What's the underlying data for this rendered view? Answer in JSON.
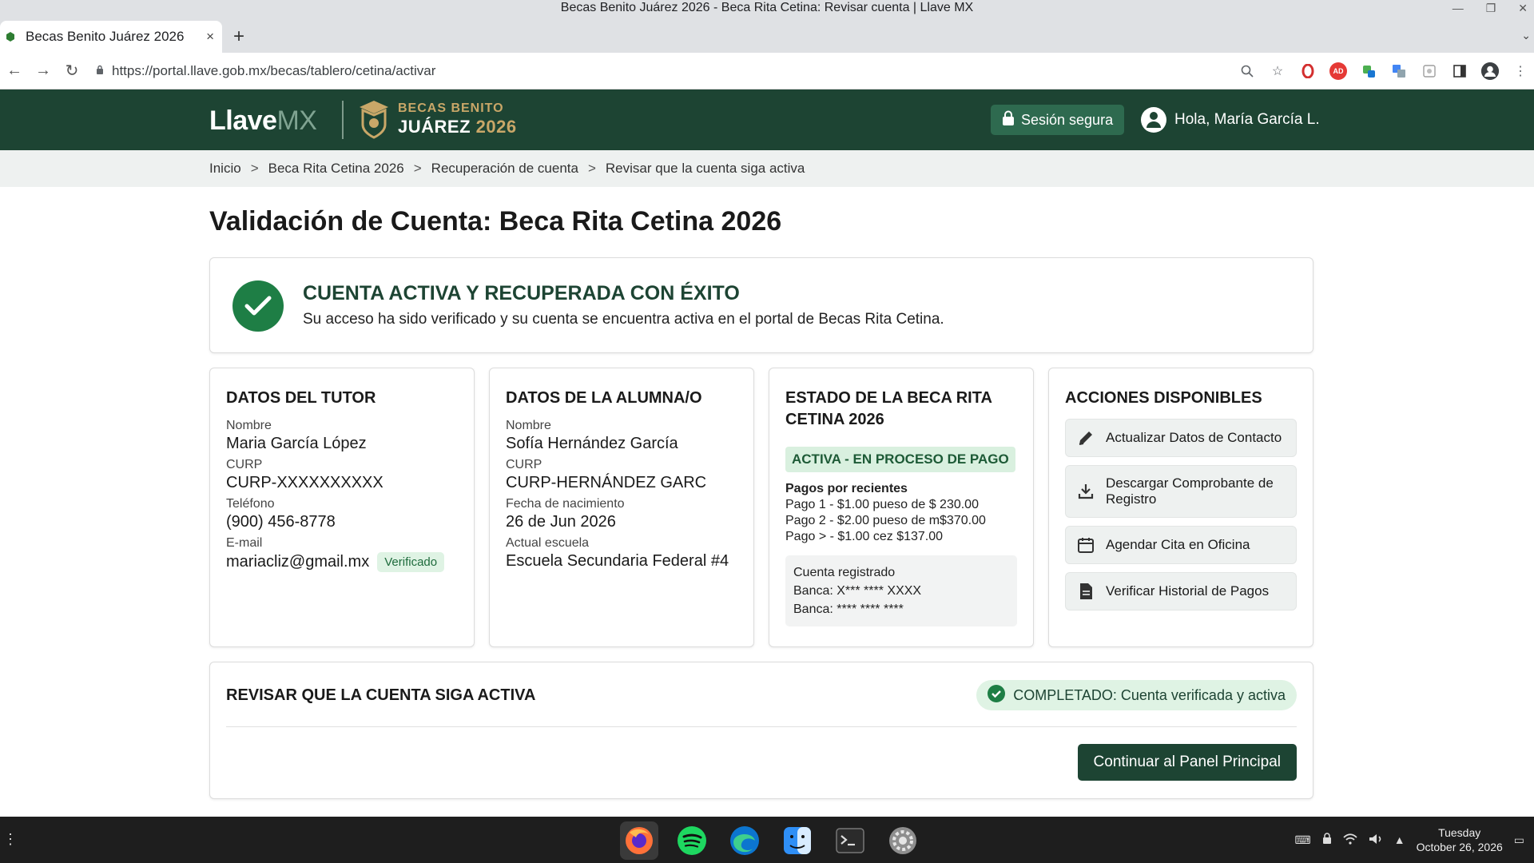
{
  "window": {
    "title": "Becas Benito Juárez 2026 - Beca Rita Cetina: Revisar cuenta | Llave MX",
    "controls": [
      "—",
      "❐",
      "✕"
    ]
  },
  "tab": {
    "title": "Becas Benito Juárez 2026",
    "close": "×",
    "new_tab": "+"
  },
  "toolbar": {
    "back": "←",
    "forward": "→",
    "reload": "↻",
    "url": "https://portal.llave.gob.mx/becas/tablero/cetina/activar"
  },
  "header": {
    "logo_llave": "Llave",
    "logo_mx": "MX",
    "becas_line1": "BECAS BENITO",
    "becas_line2": "JUÁREZ",
    "becas_year": "2026",
    "secure_label": "Sesión segura",
    "greeting": "Hola, María García L."
  },
  "breadcrumb": {
    "separator": ">",
    "items": [
      "Inicio",
      "Beca Rita Cetina 2026",
      "Recuperación de cuenta",
      "Revisar que la cuenta siga activa"
    ]
  },
  "page_title": "Validación de Cuenta: Beca Rita Cetina 2026",
  "success": {
    "title": "CUENTA ACTIVA Y RECUPERADA CON ÉXITO",
    "description": "Su acceso ha sido verificado y su cuenta se encuentra activa en el portal de Becas Rita Cetina."
  },
  "tutor": {
    "heading": "DATOS DEL TUTOR",
    "name_label": "Nombre",
    "name": "Maria García López",
    "curp_label": "CURP",
    "curp": "CURP-XXXXXXXXXX",
    "phone_label": "Teléfono",
    "phone": "(900) 456-8778",
    "email_label": "E-mail",
    "email": "mariacliz@gmail.mx",
    "verified": "Verificado"
  },
  "alumno": {
    "heading": "DATOS DE LA ALUMNA/O",
    "name_label": "Nombre",
    "name": "Sofía Hernández García",
    "curp_label": "CURP",
    "curp": "CURP-HERNÁNDEZ GARC",
    "dob_label": "Fecha de nacimiento",
    "dob": "26 de Jun 2026",
    "school_label": "Actual escuela",
    "school": "Escuela Secundaria Federal #4"
  },
  "estado": {
    "heading": "ESTADO DE LA BECA RITA CETINA 2026",
    "status": "ACTIVA - EN PROCESO DE PAGO",
    "pagos_heading": "Pagos por recientes",
    "pagos": [
      "Pago 1 - $1.00 pueso de $ 230.00",
      "Pago 2 - $2.00 pueso de m$370.00",
      "Pago > - $1.00 cez $137.00"
    ],
    "cuenta_label": "Cuenta registrado",
    "banca_1": "Banca: X*** **** XXXX",
    "banca_2": "Banca: **** **** ****"
  },
  "acciones": {
    "heading": "ACCIONES DISPONIBLES",
    "items": [
      {
        "label": "Actualizar Datos de Contacto",
        "icon": "pencil-icon"
      },
      {
        "label": "Descargar Comprobante de Registro",
        "icon": "download-icon"
      },
      {
        "label": "Agendar Cita en Oficina",
        "icon": "calendar-icon"
      },
      {
        "label": "Verificar Historial de Pagos",
        "icon": "document-icon"
      }
    ]
  },
  "review": {
    "title": "REVISAR QUE LA CUENTA SIGA ACTIVA",
    "completed": "COMPLETADO: Cuenta verificada y activa",
    "continue": "Continuar al Panel Principal"
  },
  "taskbar": {
    "apps": [
      "firefox-icon",
      "spotify-icon",
      "edge-icon",
      "finder-icon",
      "terminal-icon",
      "settings-icon"
    ],
    "clock_day": "Tuesday",
    "clock_date": "October 26, 2026"
  },
  "colors": {
    "header_green": "#1d4433",
    "accent_gold": "#c9a768",
    "success_green": "#1e7e45",
    "badge_green_bg": "#dff3e4"
  }
}
